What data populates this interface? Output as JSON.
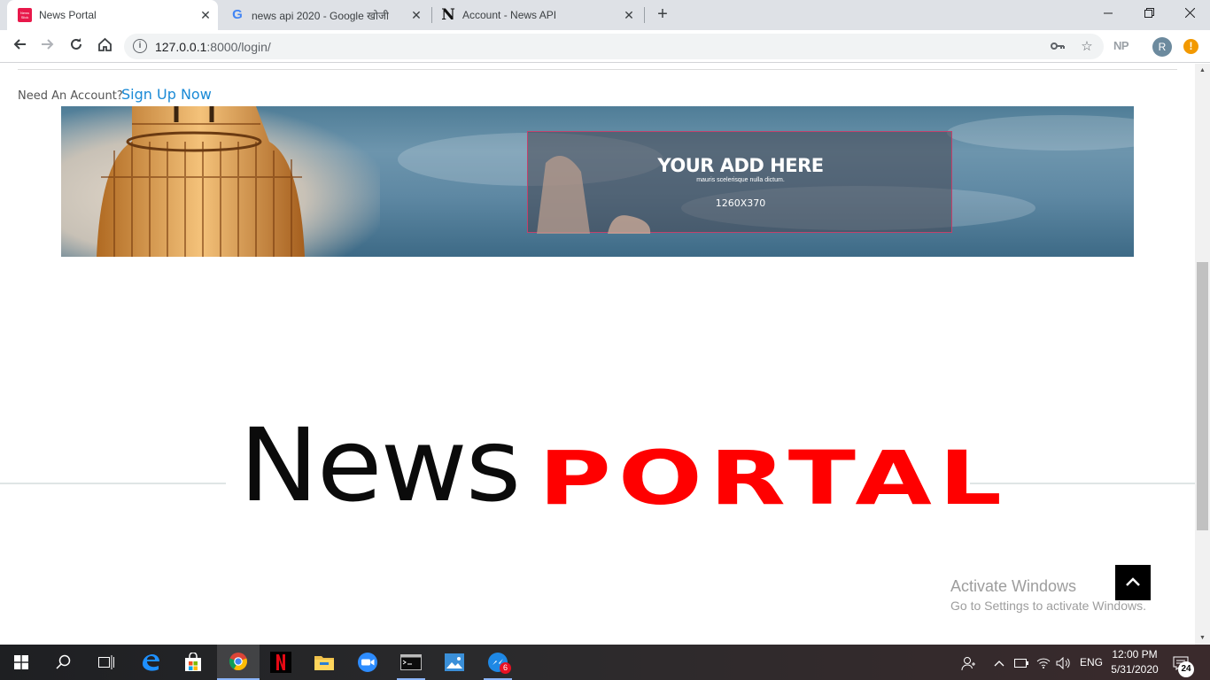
{
  "browser": {
    "tabs": [
      {
        "title": "News Portal",
        "favicon": "news-portal-favicon",
        "favicon_text": "News Slick",
        "active": true
      },
      {
        "title": "news api 2020 - Google खोजी",
        "favicon": "google-favicon",
        "favicon_text": "G",
        "active": false
      },
      {
        "title": "Account - News API",
        "favicon": "news-api-favicon",
        "favicon_text": "N",
        "active": false
      }
    ],
    "close_glyph": "✕",
    "new_tab_glyph": "+",
    "url_host": "127.0.0.1",
    "url_rest": ":8000/login/",
    "extension_label": "NP",
    "profile_initial": "R",
    "update_glyph": "!"
  },
  "page": {
    "need_account_text": "Need An Account?",
    "signup_link": "Sign Up Now",
    "ad": {
      "title": "YOUR ADD HERE",
      "subtitle": "mauris scelerisque nulla dictum.",
      "size": "1260X370",
      "border_color": "#c2426c"
    },
    "logo": {
      "part1": "News",
      "part2": "PORTAL",
      "part2_color": "#ff0000"
    },
    "back_to_top_icon": "chevron-up-icon"
  },
  "overlay": {
    "activate_title": "Activate Windows",
    "activate_subtitle": "Go to Settings to activate Windows."
  },
  "taskbar": {
    "apps": [
      "start-icon",
      "search-icon",
      "task-view-icon",
      "edge-icon",
      "store-icon",
      "chrome-icon",
      "netflix-icon",
      "file-explorer-icon",
      "zoom-icon",
      "terminal-icon",
      "photos-icon",
      "messenger-icon"
    ],
    "messenger_badge": "6",
    "language": "ENG",
    "time": "12:00 PM",
    "date": "5/31/2020",
    "notifications_count": "24"
  }
}
